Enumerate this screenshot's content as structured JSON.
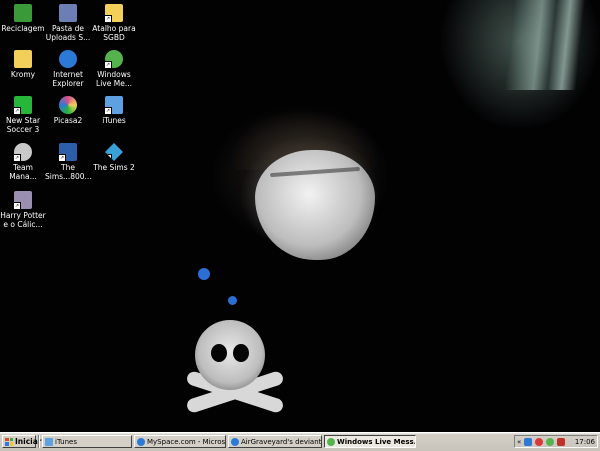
{
  "desktop": {
    "icons": [
      {
        "label": "Reciclagem",
        "name": "recycle-bin-icon",
        "color": "#3a9a3a",
        "shortcut": false
      },
      {
        "label": "Pasta de Uploads S...",
        "name": "uploads-folder-icon",
        "color": "#6b7fb5",
        "shortcut": false
      },
      {
        "label": "Atalho para SGBD",
        "name": "folder-shortcut-icon",
        "color": "#f2cf5b",
        "shortcut": true
      },
      {
        "label": "Kromy",
        "name": "folder-icon",
        "color": "#f2cf5b",
        "shortcut": false
      },
      {
        "label": "Internet Explorer",
        "name": "internet-explorer-icon",
        "color": "#2a7ad6",
        "shortcut": false
      },
      {
        "label": "Windows Live Me...",
        "name": "windows-live-messenger-icon",
        "color": "#55b34d",
        "shortcut": true
      },
      {
        "label": "New Star Soccer 3",
        "name": "new-star-soccer-icon",
        "color": "#27b53a",
        "shortcut": true
      },
      {
        "label": "Picasa2",
        "name": "picasa-icon",
        "color": "#d94f8a",
        "shortcut": false
      },
      {
        "label": "iTunes",
        "name": "itunes-icon",
        "color": "#5fa0e0",
        "shortcut": true
      },
      {
        "label": "Team Mana...",
        "name": "team-manager-icon",
        "color": "#c9c9c9",
        "shortcut": true
      },
      {
        "label": "The Sims...800...",
        "name": "the-sims-800-icon",
        "color": "#2d5ea8",
        "shortcut": true
      },
      {
        "label": "The Sims 2",
        "name": "the-sims-2-icon",
        "color": "#3aa0d8",
        "shortcut": true
      },
      {
        "label": "Harry Potter e o Cálic...",
        "name": "harry-potter-icon",
        "color": "#9a8fb0",
        "shortcut": true
      }
    ]
  },
  "taskbar": {
    "start_label": "Iniciar",
    "tasks": [
      {
        "label": "iTunes",
        "name": "task-itunes",
        "color": "#5fa0e0",
        "active": false
      },
      {
        "label": "MySpace.com - Microsoft...",
        "name": "task-myspace-ie",
        "color": "#2a7ad6",
        "active": false
      },
      {
        "label": "AirGraveyard's deviantAR...",
        "name": "task-deviantart",
        "color": "#2a7ad6",
        "active": false
      },
      {
        "label": "Windows Live Mess...",
        "name": "task-windows-live-messenger",
        "color": "#55b34d",
        "active": true
      }
    ],
    "tray": {
      "chevron": "«",
      "icons": [
        {
          "name": "network-icon",
          "color": "#2a7ad6"
        },
        {
          "name": "security-shield-icon",
          "color": "#d63a3a"
        },
        {
          "name": "messenger-tray-icon",
          "color": "#55b34d"
        },
        {
          "name": "antivirus-icon",
          "color": "#c0302a"
        }
      ],
      "clock": "17:06"
    }
  }
}
